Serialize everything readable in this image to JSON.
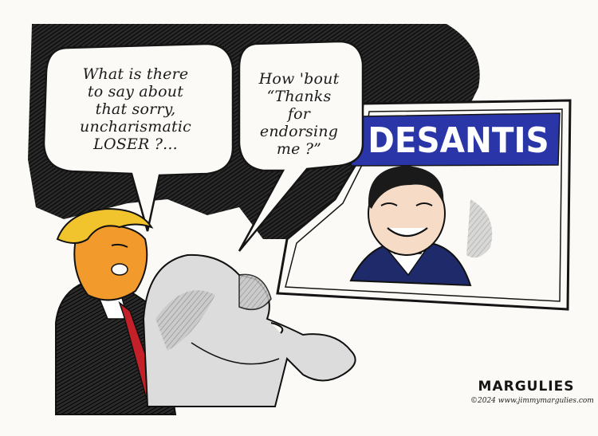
{
  "cartoon": {
    "speech_bubble_1": {
      "lines": [
        "What is there",
        "to say about",
        "that sorry,",
        "uncharismatic",
        "LOSER ?..."
      ]
    },
    "speech_bubble_2": {
      "lines": [
        "How 'bout",
        "“Thanks",
        "for",
        "endorsing",
        "me ?”"
      ]
    },
    "poster": {
      "name": "DESANTIS"
    },
    "signature": "MARGULIES",
    "copyright": "©2024 www.jimmymargulies.com"
  },
  "colors": {
    "background": "#fbfaf6",
    "ink": "#151515",
    "banner_blue": "#2a36a8",
    "tie_red": "#c4202a",
    "hair_yellow": "#f1c42e",
    "skin_orange": "#f39a2c",
    "suit_blue": "#1e2a6a",
    "elephant_gray": "#cfcfcf"
  }
}
